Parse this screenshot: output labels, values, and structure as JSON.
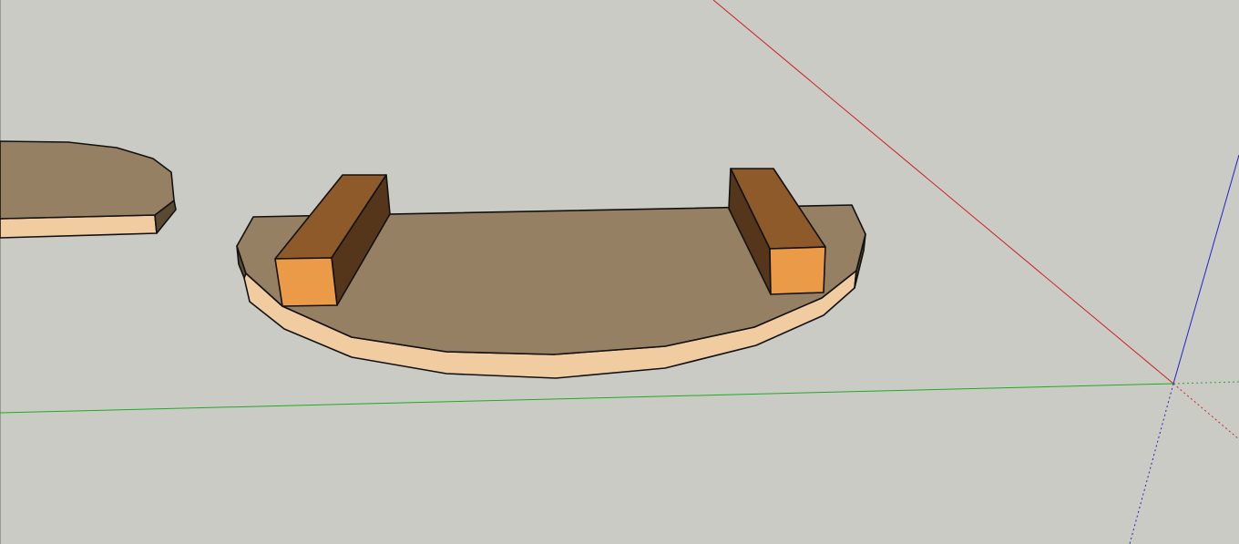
{
  "viewport": {
    "background_color": "#cbcbc6"
  },
  "axes": {
    "red_axis_color": "#cc2222",
    "green_axis_color": "#22aa22",
    "blue_axis_color": "#2222cc"
  },
  "materials": {
    "top_face_color": "#968064",
    "edge_face_color": "#f0cca0",
    "side_dark_color": "#5b4a33",
    "block_top_color": "#8f5a2a",
    "block_side_color": "#56361a",
    "block_front_color": "#eb9a48"
  },
  "scene": {
    "objects": [
      "partial-board-left",
      "curved-board",
      "block-left",
      "block-right"
    ]
  }
}
